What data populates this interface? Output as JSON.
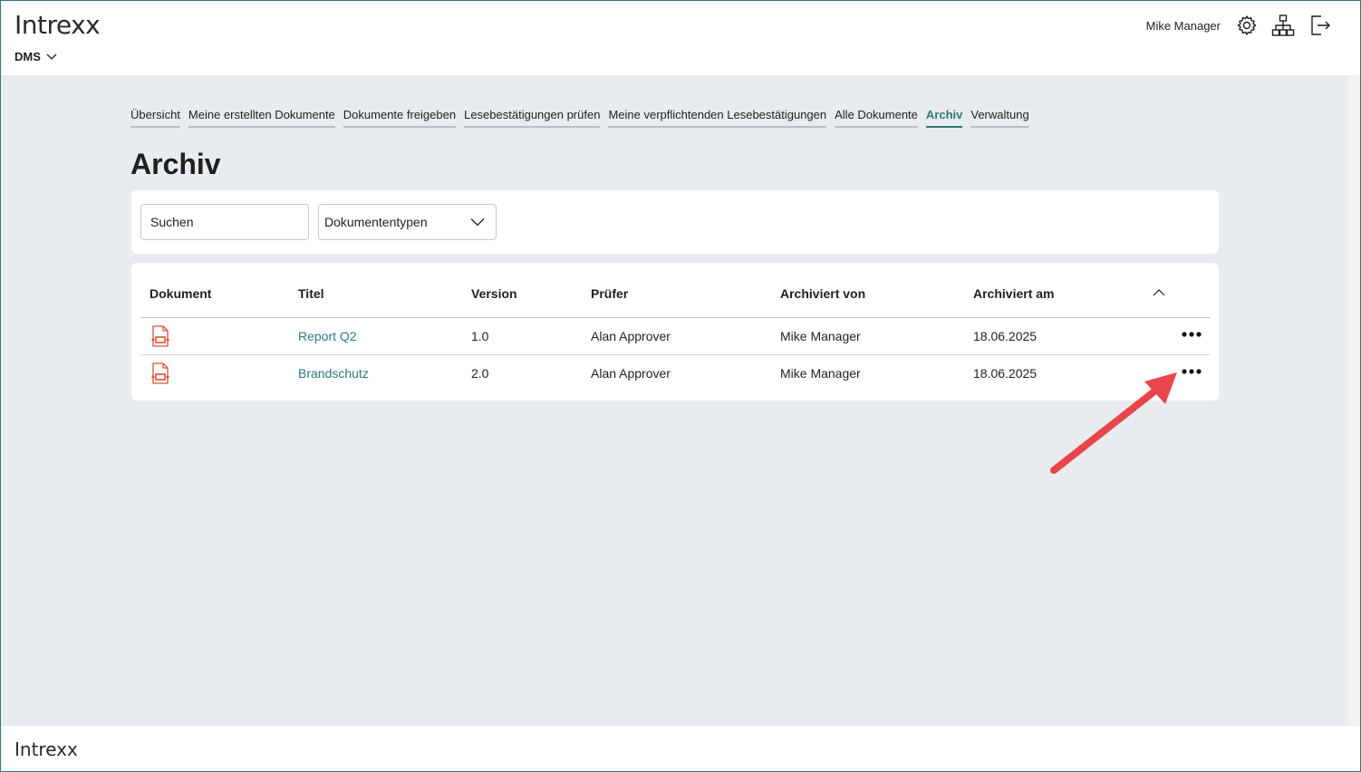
{
  "header": {
    "logo": "Intrexx",
    "app_menu": "DMS",
    "user_name": "Mike Manager",
    "icons": [
      "gear-icon",
      "sitemap-icon",
      "logout-icon"
    ]
  },
  "nav": {
    "tabs": [
      {
        "label": "Übersicht",
        "active": false
      },
      {
        "label": "Meine erstellten Dokumente",
        "active": false
      },
      {
        "label": "Dokumente freigeben",
        "active": false
      },
      {
        "label": "Lesebestätigungen prüfen",
        "active": false
      },
      {
        "label": "Meine verpflichtenden Lesebestätigungen",
        "active": false
      },
      {
        "label": "Alle Dokumente",
        "active": false
      },
      {
        "label": "Archiv",
        "active": true
      },
      {
        "label": "Verwaltung",
        "active": false
      }
    ]
  },
  "page": {
    "title": "Archiv"
  },
  "filters": {
    "search_placeholder": "Suchen",
    "doctype_label": "Dokumententypen"
  },
  "table": {
    "columns": [
      "Dokument",
      "Titel",
      "Version",
      "Prüfer",
      "Archiviert von",
      "Archiviert am"
    ],
    "rows": [
      {
        "icon": "pdf-document-icon",
        "title": "Report Q2",
        "version": "1.0",
        "pruefer": "Alan Approver",
        "archived_by": "Mike Manager",
        "archived_on": "18.06.2025"
      },
      {
        "icon": "pdf-document-icon",
        "title": "Brandschutz",
        "version": "2.0",
        "pruefer": "Alan Approver",
        "archived_by": "Mike Manager",
        "archived_on": "18.06.2025"
      }
    ]
  },
  "footer": {
    "logo": "Intrexx"
  },
  "colors": {
    "accent": "#2d7a78",
    "background": "#e8ecee",
    "annotation_arrow": "#e8464b",
    "doc_icon": "#d9533b"
  }
}
